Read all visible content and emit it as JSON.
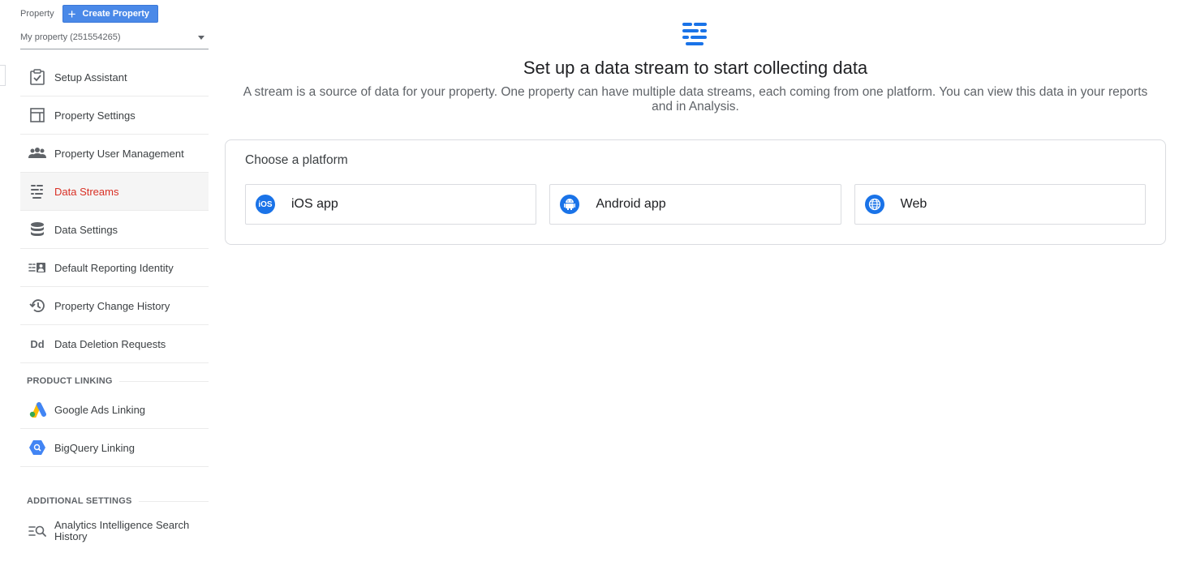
{
  "property": {
    "label": "Property",
    "create_button": "Create Property",
    "selected": "My property (251554265)"
  },
  "nav": {
    "setup_assistant": "Setup Assistant",
    "property_settings": "Property Settings",
    "property_user_management": "Property User Management",
    "data_streams": "Data Streams",
    "data_settings": "Data Settings",
    "default_reporting_identity": "Default Reporting Identity",
    "property_change_history": "Property Change History",
    "data_deletion_requests": "Data Deletion Requests",
    "data_deletion_icon_text": "Dd"
  },
  "product_linking": {
    "heading": "PRODUCT LINKING",
    "google_ads": "Google Ads Linking",
    "bigquery": "BigQuery Linking"
  },
  "additional_settings": {
    "heading": "ADDITIONAL SETTINGS",
    "analytics_search_history": "Analytics Intelligence Search History"
  },
  "main": {
    "title": "Set up a data stream to start collecting data",
    "subtitle": "A stream is a source of data for your property. One property can have multiple data streams, each coming from one platform. You can view this data in your reports and in Analysis.",
    "choose_platform": "Choose a platform",
    "platforms": [
      {
        "label": "iOS app",
        "icon": "ios-icon"
      },
      {
        "label": "Android app",
        "icon": "android-icon"
      },
      {
        "label": "Web",
        "icon": "globe-icon"
      }
    ],
    "ios_icon_text": "iOS"
  },
  "colors": {
    "accent": "#1a73e8",
    "active_nav": "#d93025",
    "create_button": "#4a89e8"
  }
}
